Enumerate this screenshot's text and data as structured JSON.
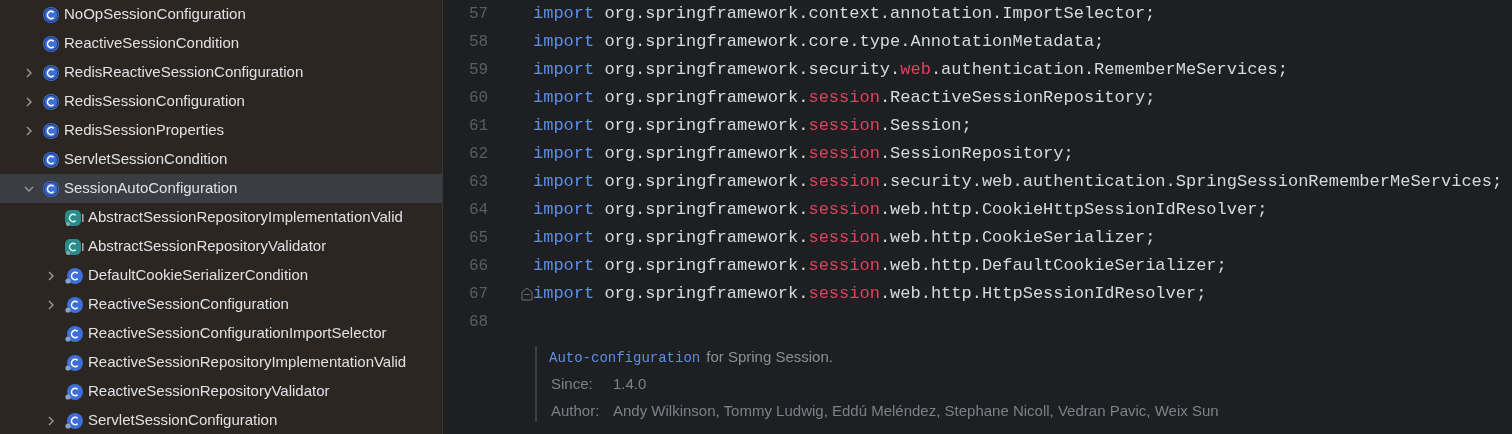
{
  "project_tree": {
    "items": [
      {
        "label": "NoOpSessionConfiguration",
        "kind": "class",
        "selected": false
      },
      {
        "label": "ReactiveSessionCondition",
        "kind": "class",
        "selected": false
      },
      {
        "label": "RedisReactiveSessionConfiguration",
        "kind": "class",
        "expanded": false,
        "selected": false
      },
      {
        "label": "RedisSessionConfiguration",
        "kind": "class",
        "expanded": false,
        "selected": false
      },
      {
        "label": "RedisSessionProperties",
        "kind": "class",
        "expanded": false,
        "selected": false
      },
      {
        "label": "ServletSessionCondition",
        "kind": "class",
        "selected": false
      },
      {
        "label": "SessionAutoConfiguration",
        "kind": "class",
        "expanded": true,
        "selected": true,
        "children": [
          {
            "label": "AbstractSessionRepositoryImplementationValid",
            "kind": "abstract-class",
            "selected": false
          },
          {
            "label": "AbstractSessionRepositoryValidator",
            "kind": "abstract-class",
            "selected": false
          },
          {
            "label": "DefaultCookieSerializerCondition",
            "kind": "inner-class",
            "expanded": false,
            "selected": false
          },
          {
            "label": "ReactiveSessionConfiguration",
            "kind": "inner-class",
            "expanded": false,
            "selected": false
          },
          {
            "label": "ReactiveSessionConfigurationImportSelector",
            "kind": "inner-class",
            "selected": false
          },
          {
            "label": "ReactiveSessionRepositoryImplementationValid",
            "kind": "inner-class",
            "selected": false
          },
          {
            "label": "ReactiveSessionRepositoryValidator",
            "kind": "inner-class",
            "selected": false
          },
          {
            "label": "ServletSessionConfiguration",
            "kind": "inner-class",
            "expanded": false,
            "selected": false
          }
        ]
      }
    ]
  },
  "editor": {
    "lines": [
      {
        "number": "57",
        "tokens": [
          {
            "kind": "keyword",
            "text": "import"
          },
          {
            "kind": "plain",
            "text": " org.springframework.context.annotation.ImportSelector;"
          }
        ]
      },
      {
        "number": "58",
        "tokens": [
          {
            "kind": "keyword",
            "text": "import"
          },
          {
            "kind": "plain",
            "text": " org.springframework.core.type.AnnotationMetadata;"
          }
        ]
      },
      {
        "number": "59",
        "tokens": [
          {
            "kind": "keyword",
            "text": "import"
          },
          {
            "kind": "plain",
            "text": " org.springframework.security."
          },
          {
            "kind": "package",
            "text": "web"
          },
          {
            "kind": "plain",
            "text": ".authentication.RememberMeServices;"
          }
        ]
      },
      {
        "number": "60",
        "tokens": [
          {
            "kind": "keyword",
            "text": "import"
          },
          {
            "kind": "plain",
            "text": " org.springframework."
          },
          {
            "kind": "package",
            "text": "session"
          },
          {
            "kind": "plain",
            "text": ".ReactiveSessionRepository;"
          }
        ]
      },
      {
        "number": "61",
        "tokens": [
          {
            "kind": "keyword",
            "text": "import"
          },
          {
            "kind": "plain",
            "text": " org.springframework."
          },
          {
            "kind": "package",
            "text": "session"
          },
          {
            "kind": "plain",
            "text": ".Session;"
          }
        ]
      },
      {
        "number": "62",
        "tokens": [
          {
            "kind": "keyword",
            "text": "import"
          },
          {
            "kind": "plain",
            "text": " org.springframework."
          },
          {
            "kind": "package",
            "text": "session"
          },
          {
            "kind": "plain",
            "text": ".SessionRepository;"
          }
        ]
      },
      {
        "number": "63",
        "tokens": [
          {
            "kind": "keyword",
            "text": "import"
          },
          {
            "kind": "plain",
            "text": " org.springframework."
          },
          {
            "kind": "package",
            "text": "session"
          },
          {
            "kind": "plain",
            "text": ".security.web.authentication.SpringSessionRememberMeServices;"
          }
        ]
      },
      {
        "number": "64",
        "tokens": [
          {
            "kind": "keyword",
            "text": "import"
          },
          {
            "kind": "plain",
            "text": " org.springframework."
          },
          {
            "kind": "package",
            "text": "session"
          },
          {
            "kind": "plain",
            "text": ".web.http.CookieHttpSessionIdResolver;"
          }
        ]
      },
      {
        "number": "65",
        "tokens": [
          {
            "kind": "keyword",
            "text": "import"
          },
          {
            "kind": "plain",
            "text": " org.springframework."
          },
          {
            "kind": "package",
            "text": "session"
          },
          {
            "kind": "plain",
            "text": ".web.http.CookieSerializer;"
          }
        ]
      },
      {
        "number": "66",
        "tokens": [
          {
            "kind": "keyword",
            "text": "import"
          },
          {
            "kind": "plain",
            "text": " org.springframework."
          },
          {
            "kind": "package",
            "text": "session"
          },
          {
            "kind": "plain",
            "text": ".web.http.DefaultCookieSerializer;"
          }
        ]
      },
      {
        "number": "67",
        "fold_marker": true,
        "tokens": [
          {
            "kind": "keyword",
            "text": "import"
          },
          {
            "kind": "plain",
            "text": " org.springframework."
          },
          {
            "kind": "package",
            "text": "session"
          },
          {
            "kind": "plain",
            "text": ".web.http.HttpSessionIdResolver;"
          }
        ]
      },
      {
        "number": "68"
      }
    ],
    "doc": {
      "link": "Auto-configuration",
      "summary": "for Spring Session.",
      "fields": [
        {
          "label": "Since:",
          "value": "1.4.0"
        },
        {
          "label": "Author:",
          "value": "Andy Wilkinson, Tommy Ludwig, Eddú Meléndez, Stephane Nicoll, Vedran Pavic, Weix Sun"
        }
      ]
    }
  }
}
